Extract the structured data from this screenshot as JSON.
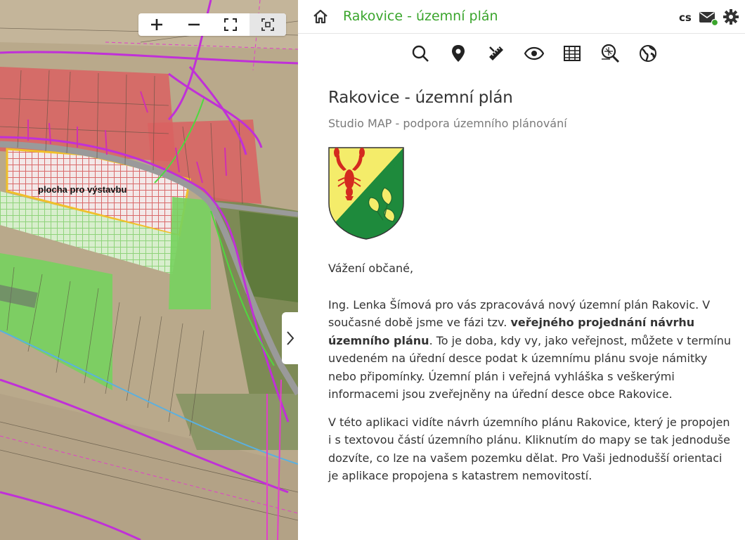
{
  "map": {
    "label": "plocha pro výstavbu",
    "controls": [
      "zoom-in",
      "zoom-out",
      "fullscreen",
      "zoom-to-extent"
    ]
  },
  "header": {
    "title": "Rakovice - územní plán",
    "language": "cs"
  },
  "toolbar": {
    "tools": [
      "search-icon",
      "location-pin-icon",
      "measure-icon",
      "eye-icon",
      "table-icon",
      "parcel-search-icon",
      "globe-icon"
    ]
  },
  "content": {
    "title": "Rakovice - územní plán",
    "subtitle": "Studio MAP - podpora územního plánování",
    "greeting": "Vážení občané,",
    "p1_a": "Ing. Lenka Šímová pro vás zpracovává nový územní plán Rakovic. V současné době jsme ve fázi tzv. ",
    "p1_bold": "veřejného projednání návrhu územního plánu",
    "p1_b": ". To je doba, kdy vy, jako veřejnost, můžete v termínu uvedeném na úřední desce podat k územnímu plánu svoje námitky nebo připomínky. Územní plán i veřejná vyhláška s veškerými informacemi jsou zveřejněny na úřední desce obce Rakovice.",
    "p2": "V této aplikaci vidíte návrh územního plánu Rakovice, který je propojen i s textovou částí územního plánu. Kliknutím do mapy se tak jednoduše dozvíte, co lze na vašem pozemku dělat. Pro Vaši jednodušší orientaci je aplikace propojena s katastrem nemovitostí."
  },
  "colors": {
    "accent": "#3aa52c",
    "status_dot": "#3aa52c"
  }
}
